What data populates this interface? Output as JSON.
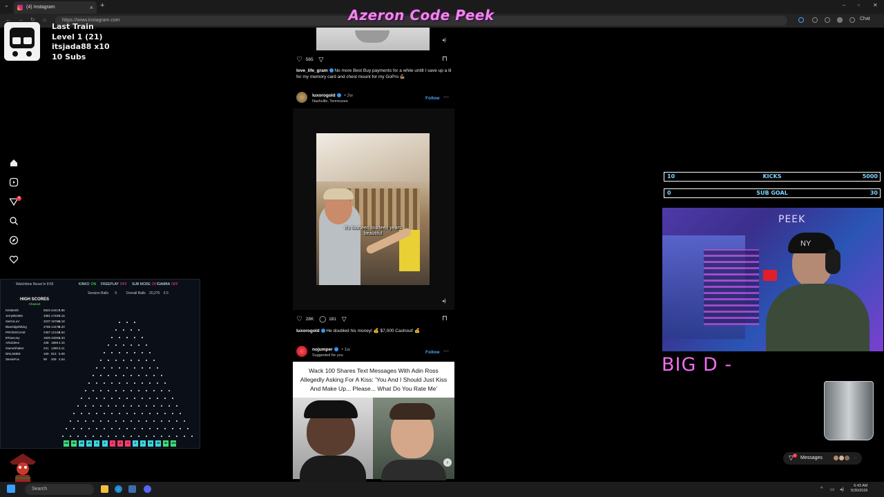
{
  "browser": {
    "tab_title": "(4) Instagram",
    "url": "https://www.instagram.com",
    "chat_label": "Chat"
  },
  "stream_title": "Azeron Code Peek",
  "train": {
    "title": "Last Train",
    "level": "Level 1  (21)",
    "user": "itsjada88 x10",
    "subs": "10 Subs"
  },
  "feed": {
    "post1": {
      "likes": "565",
      "username": "love_life_gram",
      "caption": "No more Best Buy payments for a while untill I save up a lil for my memory card and chest mount for my GoPro 💪🏽"
    },
    "post2": {
      "username": "luxorogold",
      "time": "• 2w",
      "location": "Nashville, Tennessee",
      "follow": "Follow",
      "video_subtitle": "it's fourteen fourteen years\nbeautiful",
      "likes": "28K",
      "comments": "181",
      "caption_user": "luxorogold",
      "caption": "He doubled his money! 💰 $7,000 Cashout! 💰"
    },
    "post3": {
      "username": "nojumper",
      "time": "• 1w",
      "sub": "Suggested for you",
      "follow": "Follow",
      "headline": "Wack 100 Shares Text Messages With Adin Ross Allegedly Asking For A Kiss: 'You And I Should Just Kiss And Make Up... Please... What Do You Rate Me'"
    }
  },
  "plinko": {
    "watchtime": "Watchtime Reset In 8:55",
    "modes": [
      {
        "label": "KINKO",
        "state": "ON",
        "color": "#4cff4c"
      },
      {
        "label": "FREEPLAY",
        "state": "OFF",
        "color": "#ff4c8a"
      },
      {
        "label": "SUB MODE",
        "state": "OFF",
        "color": "#ff4c8a"
      },
      {
        "label": "GAMBA",
        "state": "OFF",
        "color": "#ff4c8a"
      }
    ],
    "session_balls_label": "Session Balls",
    "session_balls": "0",
    "overall_balls_label": "Overall Balls",
    "overall_balls": "20,276",
    "overall_extra": "0  0",
    "high_scores_title": "HIGH SCORES",
    "high_scores_sub": "Channel",
    "high_scores": [
      {
        "name": "Kristtenth",
        "a": "5022",
        "b": "24417",
        "c": "4.86"
      },
      {
        "name": "Jerry851992",
        "a": "3381",
        "b": "17457",
        "c": "5.15"
      },
      {
        "name": "SwGoLuV",
        "a": "3237",
        "b": "16766",
        "c": "5.18"
      },
      {
        "name": "Blueridgehiking",
        "a": "2785",
        "b": "14478",
        "c": "5.20"
      },
      {
        "name": "PRODSCIIAM",
        "a": "2457",
        "b": "12123",
        "c": "4.94"
      },
      {
        "name": "BTownJoy",
        "a": "1925",
        "b": "10251",
        "c": "5.33"
      },
      {
        "name": "Arkoldees",
        "a": "438",
        "b": "1869",
        "c": "4.15"
      },
      {
        "name": "GameShaker",
        "a": "221",
        "b": "1350",
        "c": "6.11"
      },
      {
        "name": "DNLSMEE",
        "a": "160",
        "b": "813",
        "c": "5.08"
      },
      {
        "name": "StevieFox",
        "a": "90",
        "b": "409",
        "c": "4.54"
      }
    ],
    "buckets": [
      {
        "v": "100",
        "c": "#3be07a"
      },
      {
        "v": "50",
        "c": "#3be07a"
      },
      {
        "v": "25",
        "c": "#3bd6e0"
      },
      {
        "v": "10",
        "c": "#3bd6e0"
      },
      {
        "v": "5",
        "c": "#3bd6e0"
      },
      {
        "v": "2",
        "c": "#3bd6e0"
      },
      {
        "v": "-1",
        "c": "#ff3b6b"
      },
      {
        "v": "-2",
        "c": "#ff3b6b"
      },
      {
        "v": "-1",
        "c": "#ff3b6b"
      },
      {
        "v": "2",
        "c": "#3bd6e0"
      },
      {
        "v": "5",
        "c": "#3bd6e0"
      },
      {
        "v": "10",
        "c": "#3bd6e0"
      },
      {
        "v": "25",
        "c": "#3bd6e0"
      },
      {
        "v": "50",
        "c": "#3be07a"
      },
      {
        "v": "100",
        "c": "#3be07a"
      }
    ]
  },
  "kicks_bar": {
    "left": "10",
    "label": "KICKS",
    "right": "5000"
  },
  "subgoal_bar": {
    "left": "0",
    "label": "SUB GOAL",
    "right": "30"
  },
  "webcam_label": "PEEK",
  "big_text": "BIG D -",
  "messages": {
    "label": "Messages",
    "badge": "1"
  },
  "taskbar": {
    "search": "Search",
    "time": "6:43 AM",
    "date": "5/30/2026"
  },
  "colors": {
    "accent_pink": "#f287e8",
    "ig_blue": "#4aa3ff",
    "bar_text": "#7dd6ff"
  }
}
